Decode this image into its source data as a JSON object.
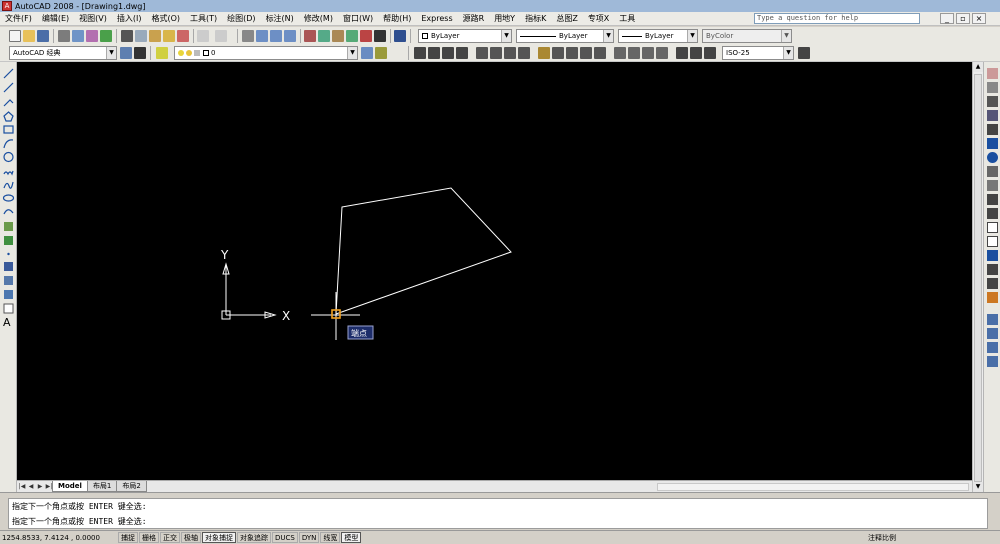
{
  "title_bar": {
    "app_icon": "autocad-logo-icon",
    "title": "AutoCAD 2008 - [Drawing1.dwg]"
  },
  "menu": {
    "items": [
      "文件(F)",
      "编辑(E)",
      "视图(V)",
      "插入(I)",
      "格式(O)",
      "工具(T)",
      "绘图(D)",
      "标注(N)",
      "修改(M)",
      "窗口(W)",
      "帮助(H)",
      "Express",
      "源路R",
      "用地Y",
      "指标K",
      "总图Z",
      "专项X",
      "工具"
    ],
    "help_placeholder": "Type a question for help",
    "controls": {
      "minimize": "_",
      "restore": "▫",
      "close": "×"
    }
  },
  "toolbar2": {
    "workspace": "AutoCAD 经典",
    "layer_value": "0",
    "color_value": "ByLayer",
    "linetype_value": "ByLayer",
    "lineweight_value": "ByLayer",
    "plotstyle_value": "ByColor"
  },
  "toolbar3": {
    "dimstyle_value": "ISO-25"
  },
  "drawing": {
    "polyline_color": "#ffffff",
    "ucs_labels": {
      "x": "X",
      "y": "Y"
    },
    "snap_tooltip": "端点",
    "cursor_color": "#ffffff",
    "marker_color": "#f0a020"
  },
  "layout_tabs": [
    "Model",
    "布局1",
    "布局2"
  ],
  "command_lines": [
    "指定下一个角点或按 ENTER 键全选:",
    "指定下一个角点或按 ENTER 键全选:"
  ],
  "status": {
    "coords": "1254.8533, 7.4124  , 0.0000",
    "buttons": [
      {
        "label": "捕捉",
        "on": false
      },
      {
        "label": "栅格",
        "on": false
      },
      {
        "label": "正交",
        "on": false
      },
      {
        "label": "极轴",
        "on": false
      },
      {
        "label": "对象捕捉",
        "on": true
      },
      {
        "label": "对象追踪",
        "on": false
      },
      {
        "label": "DUCS",
        "on": false
      },
      {
        "label": "DYN",
        "on": false
      },
      {
        "label": "线宽",
        "on": false
      },
      {
        "label": "模型",
        "on": true
      }
    ],
    "annotation": "注释比例"
  }
}
